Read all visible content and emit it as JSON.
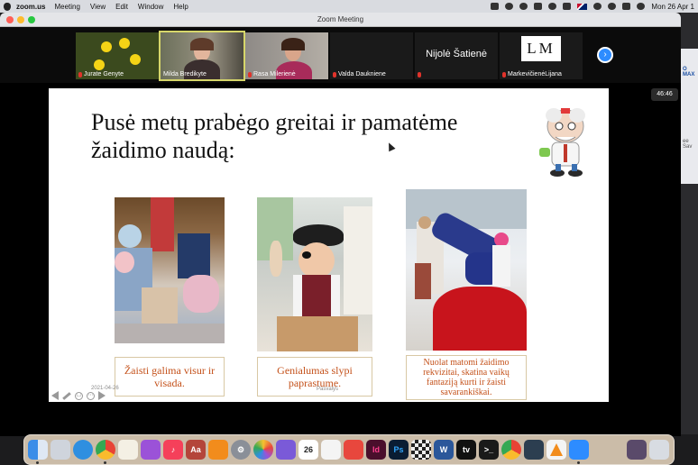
{
  "menubar": {
    "app": "zoom.us",
    "items": [
      "Meeting",
      "View",
      "Edit",
      "Window",
      "Help"
    ],
    "clock": "Mon 26 Apr 1"
  },
  "window": {
    "title": "Zoom Meeting",
    "timer": "46:46"
  },
  "participants": [
    {
      "name": "Jurate Genyte"
    },
    {
      "name": "Milda Bredikyte"
    },
    {
      "name": "Rasa Milerienė"
    },
    {
      "name": "Valda Daukniene"
    },
    {
      "name": "Nijolė Šatienė",
      "label": "Nijolė Šatienė"
    },
    {
      "name": "MarkevičienėLijana",
      "logo": "LM"
    }
  ],
  "slide": {
    "headline_line1": "Pusė metų prabėgo greitai ir pamatėme",
    "headline_line2": "žaidimo naudą:",
    "captions": [
      {
        "line1": "Žaisti galima visur ir",
        "line2": "visada."
      },
      {
        "line1": "Genialumas slypi",
        "line2": "paprastume."
      },
      {
        "line1": "Nuolat matomi žaidimo",
        "line2": "rekvizitai, skatina vaikų",
        "line3": "fantaziją kurti ir žaisti",
        "line4": "savarankiškai."
      }
    ],
    "date": "2021-04-26",
    "footer": "Pasvalys"
  },
  "rightstrip": {
    "text1": "O MAX",
    "text2": "ee Sav"
  },
  "colors": {
    "caption_text": "#c4511a",
    "caption_border": "#d8c8a4",
    "zoom_blue": "#2d8cff",
    "active_speaker": "#d6d66a"
  },
  "dock_apps": [
    "finder-icon",
    "launchpad-icon",
    "safari-icon",
    "chrome-icon",
    "notes-icon",
    "podcasts-icon",
    "music-icon",
    "dictionary-icon",
    "books-icon",
    "system-preferences-icon",
    "photos-icon",
    "app-icon",
    "calendar-icon",
    "reminders-icon",
    "keynote-icon",
    "indesign-icon",
    "photoshop-icon",
    "chess-icon",
    "word-icon",
    "appletv-icon",
    "terminal-icon",
    "chrome-icon-2",
    "app-icon-2",
    "vlc-icon",
    "zoom-icon",
    "downloads-icon",
    "trash-icon"
  ],
  "dock_labels": {
    "calendar_day": "26",
    "indesign": "Id",
    "photoshop": "Ps",
    "dictionary": "Aa",
    "appletv": "tv"
  }
}
